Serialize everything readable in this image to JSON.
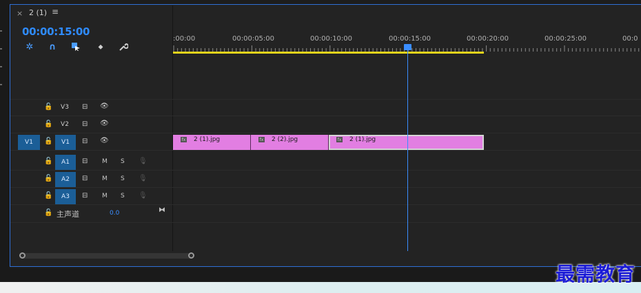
{
  "tab": {
    "close_icon": "close-icon",
    "title": "2 (1)",
    "menu_icon": "menu-icon"
  },
  "timecode": "00:00:15:00",
  "tools": [
    {
      "name": "nest-toggle-icon",
      "glyph": "✲"
    },
    {
      "name": "snap-magnet-icon",
      "glyph": "∩"
    },
    {
      "name": "linked-selection-icon",
      "glyph": "⧉"
    },
    {
      "name": "add-marker-icon",
      "glyph": "⬥"
    },
    {
      "name": "settings-wrench-icon",
      "glyph": "🔧"
    }
  ],
  "ruler": {
    "labels": [
      ":00:00",
      "00:00:05:00",
      "00:00:10:00",
      "00:00:15:00",
      "00:00:20:00",
      "00:00:25:00",
      "00:0"
    ]
  },
  "video_tracks": [
    {
      "id": "V3",
      "source": "",
      "active": false
    },
    {
      "id": "V2",
      "source": "",
      "active": false
    },
    {
      "id": "V1",
      "source": "V1",
      "active": true
    }
  ],
  "audio_tracks": [
    {
      "id": "A1",
      "mute": "M",
      "solo": "S"
    },
    {
      "id": "A2",
      "mute": "M",
      "solo": "S"
    },
    {
      "id": "A3",
      "mute": "M",
      "solo": "S"
    }
  ],
  "master": {
    "label": "主声道",
    "value": "0.0"
  },
  "clips": [
    {
      "name": "2 (1).jpg",
      "fx": "fx"
    },
    {
      "name": "2 (2).jpg",
      "fx": "fx"
    },
    {
      "name": "2 (1).jpg",
      "fx": "fx"
    }
  ],
  "watermark": "最需教育",
  "colors": {
    "accent": "#2f8bff",
    "clip": "#e27ee2",
    "track_active": "#1b5e97",
    "work_area": "#e6d41b"
  }
}
